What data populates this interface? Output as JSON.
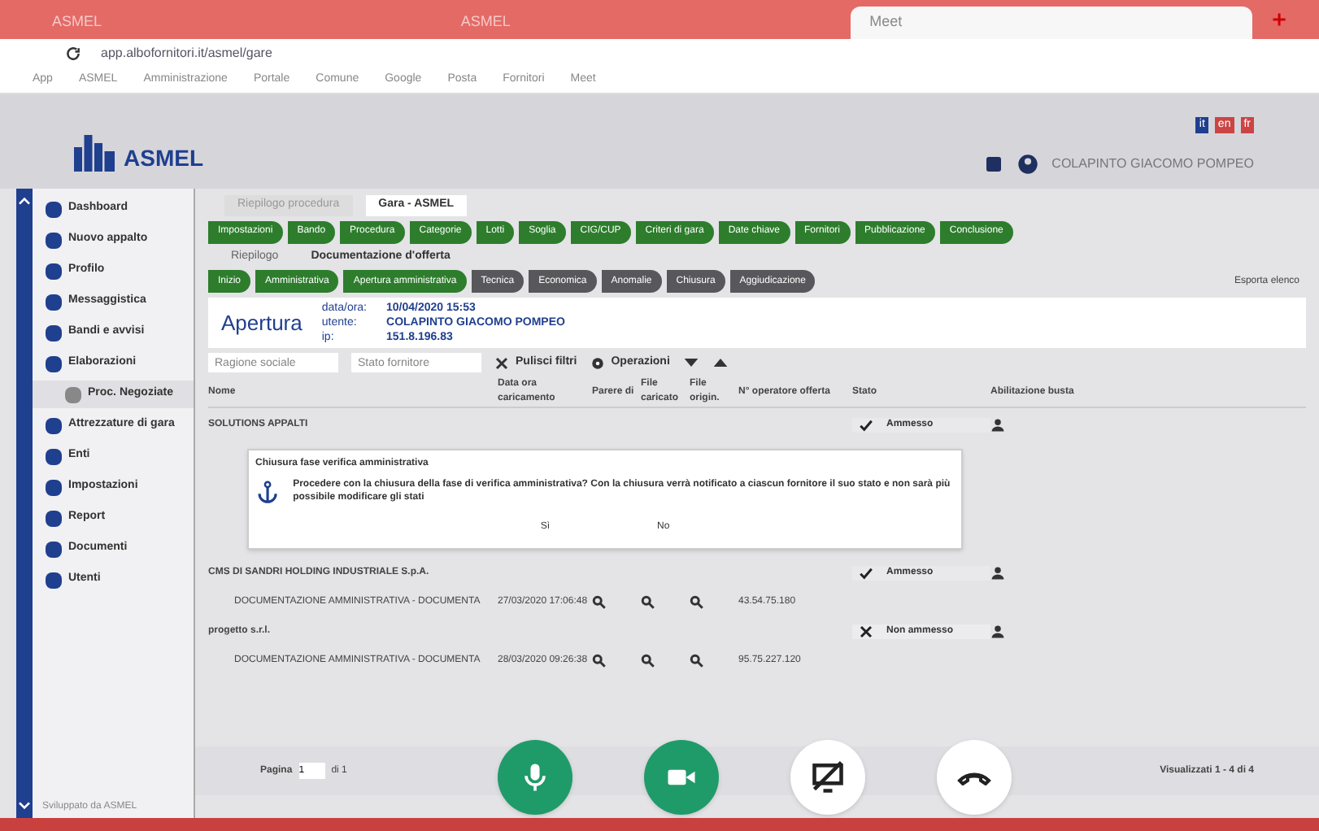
{
  "browser": {
    "tabs": [
      {
        "title": "ASMEL",
        "selected": false
      },
      {
        "title": "ASMEL",
        "selected": false
      },
      {
        "title": "Meet",
        "selected": true
      }
    ],
    "address": "app.albofornitori.it/asmel/gare",
    "bookmarks": [
      "App",
      "ASMEL",
      "Amministrazione",
      "Portale",
      "Comune",
      "Google",
      "Posta",
      "Fornitori",
      "Meet"
    ]
  },
  "header": {
    "logo": "ASMEL",
    "user": "COLAPINTO GIACOMO POMPEO",
    "languages": [
      {
        "code": "it",
        "selected": true
      },
      {
        "code": "en",
        "selected": false
      },
      {
        "code": "fr",
        "selected": false
      }
    ]
  },
  "sidebar": {
    "items": [
      {
        "label": "Dashboard",
        "kind": "main",
        "selected": false
      },
      {
        "label": "Nuovo appalto",
        "kind": "main",
        "selected": false
      },
      {
        "label": "Profilo",
        "kind": "main",
        "selected": false
      },
      {
        "label": "Messaggistica",
        "kind": "main",
        "selected": false
      },
      {
        "label": "Bandi e avvisi",
        "kind": "main",
        "selected": false
      },
      {
        "label": "Elaborazioni",
        "kind": "main",
        "selected": false
      },
      {
        "label": "Proc. Negoziate",
        "kind": "sub",
        "selected": true
      },
      {
        "label": "Attrezzature di gara",
        "kind": "main",
        "selected": false
      },
      {
        "label": "Enti",
        "kind": "main",
        "selected": false
      },
      {
        "label": "Impostazioni",
        "kind": "main",
        "selected": false
      },
      {
        "label": "Report",
        "kind": "main",
        "selected": false
      },
      {
        "label": "Documenti",
        "kind": "main",
        "selected": false
      },
      {
        "label": "Utenti",
        "kind": "main",
        "selected": false
      }
    ]
  },
  "breadcrumb_tabs": [
    {
      "label": "Riepilogo procedura",
      "selected": false
    },
    {
      "label": "Gara - ASMEL",
      "selected": true
    }
  ],
  "steps_top": [
    {
      "label": "Impostazioni",
      "done": true
    },
    {
      "label": "Bando",
      "done": true
    },
    {
      "label": "Procedura",
      "done": true
    },
    {
      "label": "Categorie",
      "done": true
    },
    {
      "label": "Lotti",
      "done": true
    },
    {
      "label": "Soglia",
      "done": true
    },
    {
      "label": "CIG/CUP",
      "done": true
    },
    {
      "label": "Criteri di gara",
      "done": true
    },
    {
      "label": "Date chiave",
      "done": true
    },
    {
      "label": "Fornitori",
      "done": true
    },
    {
      "label": "Pubblicazione",
      "done": true
    },
    {
      "label": "Conclusione",
      "done": true
    }
  ],
  "sub_tabs": [
    {
      "label": "Riepilogo",
      "selected": false
    },
    {
      "label": "Documentazione d'offerta",
      "selected": true
    }
  ],
  "steps_bottom": [
    {
      "label": "Inizio",
      "done": true
    },
    {
      "label": "Amministrativa",
      "done": true
    },
    {
      "label": "Apertura amministrativa",
      "done": true
    },
    {
      "label": "Tecnica",
      "done": false
    },
    {
      "label": "Economica",
      "done": false
    },
    {
      "label": "Anomalie",
      "done": false
    },
    {
      "label": "Chiusura",
      "done": false
    },
    {
      "label": "Aggiudicazione",
      "done": false
    }
  ],
  "export": "Esporta elenco",
  "phase": {
    "title": "Apertura",
    "fields": [
      {
        "label": "data/ora:",
        "value": "10/04/2020 15:53"
      },
      {
        "label": "utente:",
        "value": "COLAPINTO GIACOMO POMPEO"
      },
      {
        "label": "ip:",
        "value": "151.8.196.83"
      }
    ]
  },
  "filters": {
    "placeholders": [
      "Ragione sociale",
      "Stato fornitore"
    ],
    "clear": "Pulisci filtri",
    "operations": "Operazioni"
  },
  "table": {
    "columns": [
      "Nome",
      "Data ora caricamento",
      "Parere di",
      "File caricato",
      "File origin.",
      "N° operatore offerta",
      "Stato",
      "Abilitazione busta"
    ],
    "groups": [
      {
        "name": "SOLUTIONS APPALTI",
        "status": "Ammesso",
        "approved": true
      },
      {
        "name": "CMS DI SANDRI HOLDING INDUSTRIALE S.p.A.",
        "status": "Ammesso",
        "approved": true,
        "rows": [
          {
            "name": "DOCUMENTAZIONE AMMINISTRATIVA - DOCUMENTA",
            "date": "27/03/2020 17:06:48",
            "amount": "43.54.75.180"
          }
        ]
      },
      {
        "name": "progetto s.r.l.",
        "status": "Non ammesso",
        "approved": false,
        "rows": [
          {
            "name": "DOCUMENTAZIONE AMMINISTRATIVA - DOCUMENTA",
            "date": "28/03/2020 09:26:38",
            "amount": "95.75.227.120"
          }
        ]
      }
    ]
  },
  "dialog": {
    "title": "Chiusura fase verifica amministrativa",
    "message": "Procedere con la chiusura della fase di verifica amministrativa? Con la chiusura verrà notificato a ciascun fornitore il suo stato e non sarà più possibile modificare gli stati",
    "buttons": [
      "Sì",
      "No"
    ]
  },
  "pager": {
    "label": "Pagina",
    "page": "1",
    "of": "di 1",
    "summary": "Visualizzati 1 - 4 di 4"
  },
  "footer": "Sviluppato da ASMEL",
  "call": [
    {
      "kind": "mic",
      "on": true
    },
    {
      "kind": "camera",
      "on": true
    },
    {
      "kind": "present",
      "on": false
    },
    {
      "kind": "hangup",
      "on": false
    }
  ]
}
